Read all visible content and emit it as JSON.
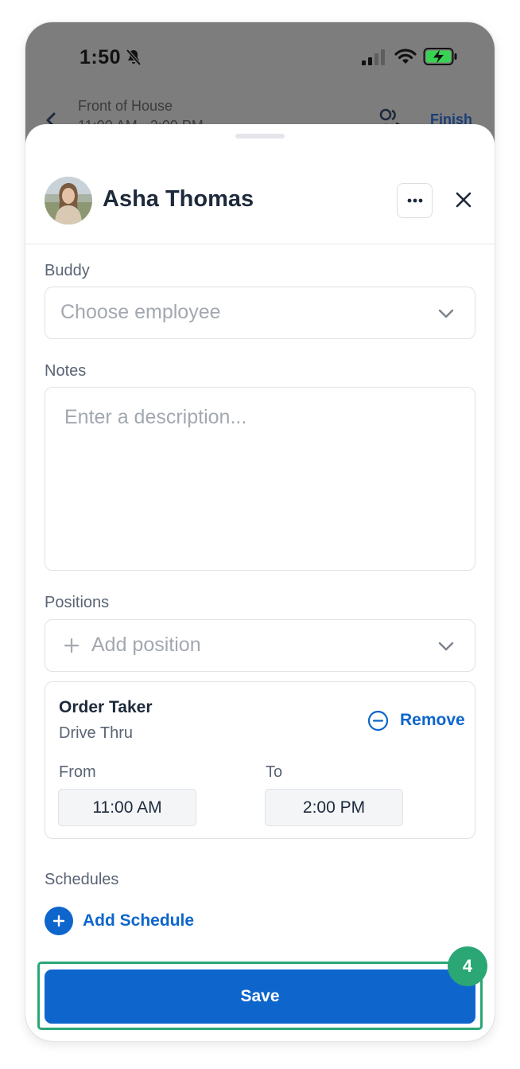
{
  "status_bar": {
    "time": "1:50"
  },
  "background_header": {
    "title": "Front of House",
    "subtitle": "11:00 AM - 2:00 PM",
    "finish_label": "Finish"
  },
  "sheet": {
    "employee_name": "Asha Thomas",
    "buddy": {
      "label": "Buddy",
      "placeholder": "Choose employee"
    },
    "notes": {
      "label": "Notes",
      "placeholder": "Enter a description..."
    },
    "positions": {
      "label": "Positions",
      "add_placeholder": "Add position",
      "items": [
        {
          "name": "Order Taker",
          "area": "Drive Thru",
          "remove_label": "Remove",
          "from_label": "From",
          "to_label": "To",
          "from": "11:00 AM",
          "to": "2:00 PM"
        }
      ]
    },
    "schedules": {
      "label": "Schedules",
      "add_label": "Add Schedule"
    },
    "save_label": "Save"
  },
  "annotation": {
    "step_number": "4"
  },
  "colors": {
    "primary": "#0e66cc",
    "highlight": "#2aa775",
    "overlay": "#7d7d7d"
  }
}
